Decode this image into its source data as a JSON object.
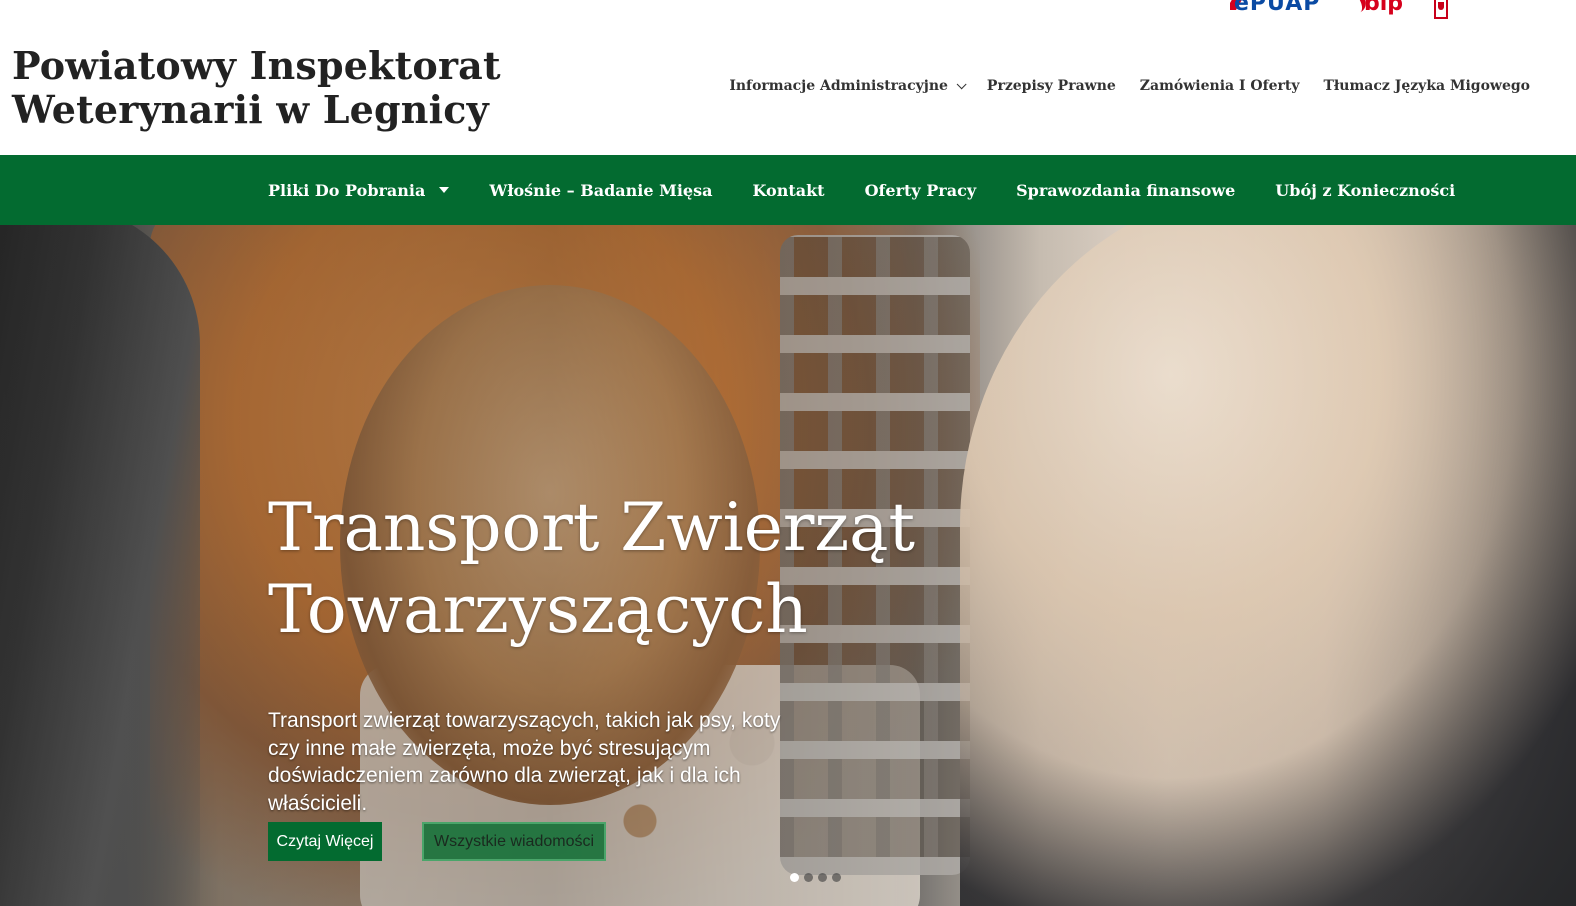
{
  "header": {
    "title_line1": "Powiatowy Inspektorat",
    "title_line2": "Weterynarii w Legnicy",
    "logos": {
      "epuap": "ePUAP",
      "bip": "bip",
      "emblem_icon": "polish-eagle-emblem-icon"
    }
  },
  "top_nav": {
    "items": [
      {
        "label": "Informacje Administracyjne",
        "has_dropdown": true
      },
      {
        "label": "Przepisy Prawne"
      },
      {
        "label": "Zamówienia I Oferty"
      },
      {
        "label": "Tłumacz Języka Migowego"
      }
    ]
  },
  "main_nav": {
    "background": "#036b30",
    "items": [
      {
        "label": "Pliki Do Pobrania",
        "has_dropdown": true
      },
      {
        "label": "Włośnie – Badanie Mięsa"
      },
      {
        "label": "Kontakt"
      },
      {
        "label": "Oferty Pracy"
      },
      {
        "label": "Sprawozdania finansowe"
      },
      {
        "label": "Ubój z Konieczności"
      }
    ]
  },
  "hero": {
    "title_line1": "Transport Zwierząt",
    "title_line2": "Towarzyszących",
    "text": "Transport zwierząt towarzyszących, takich jak psy, koty czy inne małe zwierzęta, może być stresującym doświadczeniem zarówno dla zwierząt, jak i dla ich właścicieli.",
    "read_more": "Czytaj Więcej",
    "all_news": "Wszystkie wiadomości",
    "slides": 4,
    "active_slide": 1
  }
}
